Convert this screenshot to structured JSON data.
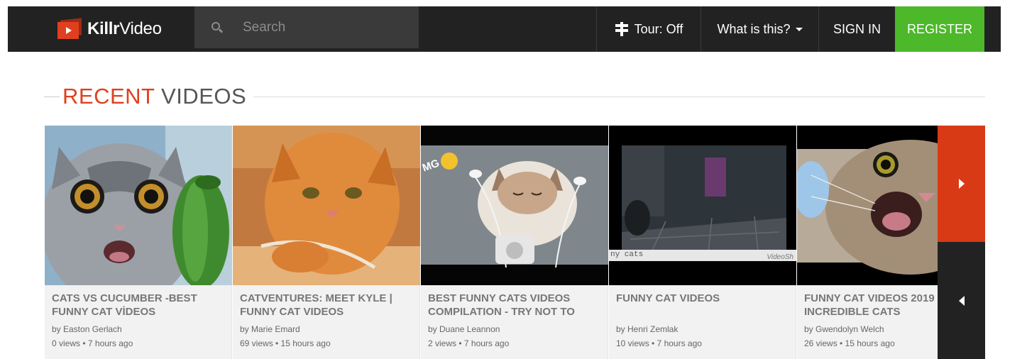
{
  "navbar": {
    "brand_bold": "Killr",
    "brand_light": "Video",
    "search_placeholder": "Search",
    "tour_label": "Tour: Off",
    "what_label": "What is this?",
    "signin_label": "SIGN IN",
    "register_label": "REGISTER"
  },
  "section": {
    "heading_accent": "RECENT",
    "heading_rest": " VIDEOS"
  },
  "videos": [
    {
      "title": "CATS VS CUCUMBER -BEST FUNNY CAT VİDEOS",
      "author": "by Easton Gerlach",
      "stats": "0 views • 7 hours ago"
    },
    {
      "title": "CATVENTURES: MEET KYLE | FUNNY CAT VIDEOS",
      "author": "by Marie Emard",
      "stats": "69 views • 15 hours ago"
    },
    {
      "title": "BEST FUNNY CATS VIDEOS COMPILATION - TRY NOT TO",
      "author": "by Duane Leannon",
      "stats": "2 views • 7 hours ago"
    },
    {
      "title": "FUNNY CAT VIDEOS",
      "author": "by Henri Zemlak",
      "stats": "10 views • 7 hours ago"
    },
    {
      "title": "FUNNY CAT VIDEOS 2019 INCREDIBLE CATS",
      "author": "by Gwendolyn Welch",
      "stats": "26 views • 15 hours ago"
    }
  ],
  "thumb_overlays": {
    "thumb3_caption": "MG",
    "thumb4_caption": "ny cats",
    "thumb4_watermark": "VideoSh"
  },
  "colors": {
    "navbar_bg": "#222222",
    "brand_red": "#e0401e",
    "register_green": "#4cb82a",
    "next_red": "#d93a16",
    "prev_dark": "#222222"
  }
}
